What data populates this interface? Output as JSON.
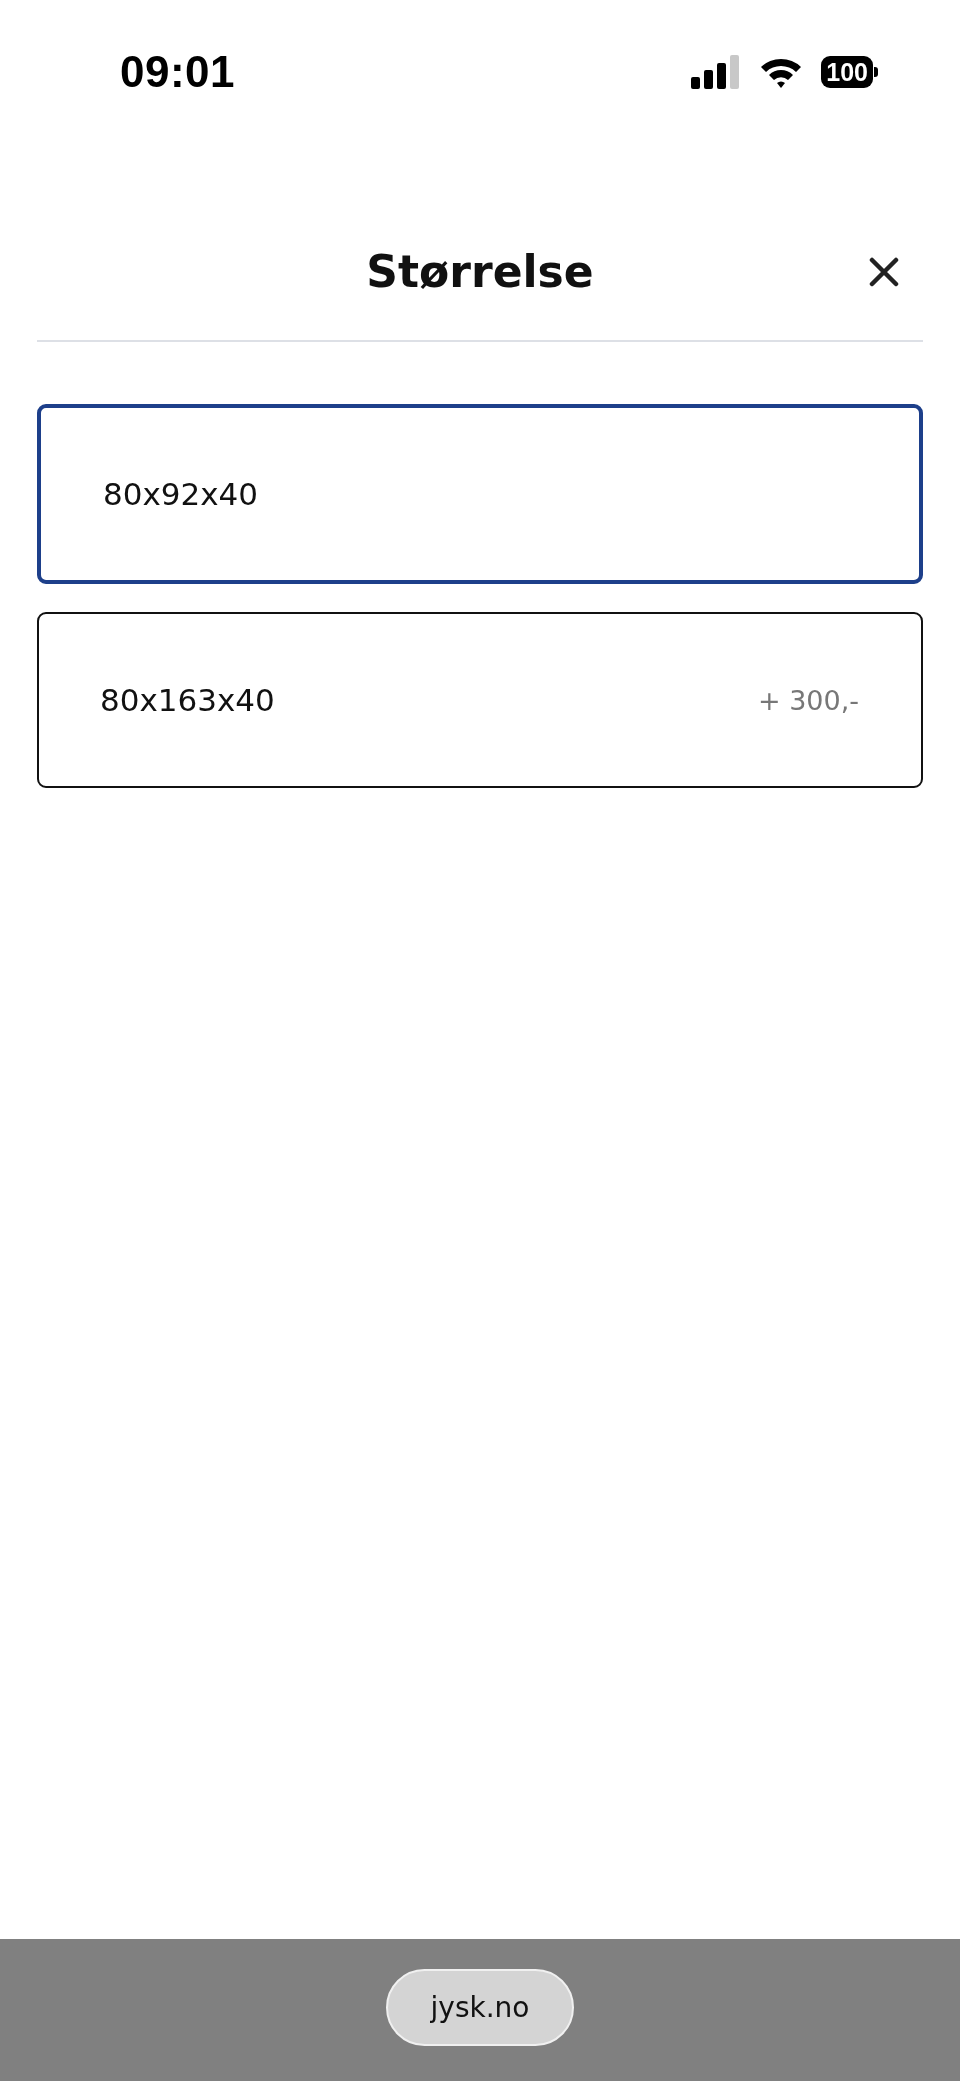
{
  "status_bar": {
    "time": "09:01",
    "battery": "100"
  },
  "header": {
    "title": "Størrelse"
  },
  "options": [
    {
      "label": "80x92x40",
      "selected": true
    },
    {
      "label": "80x163x40",
      "price": "+ 300,-",
      "selected": false
    }
  ],
  "browser_bar": {
    "url": "jysk.no"
  }
}
